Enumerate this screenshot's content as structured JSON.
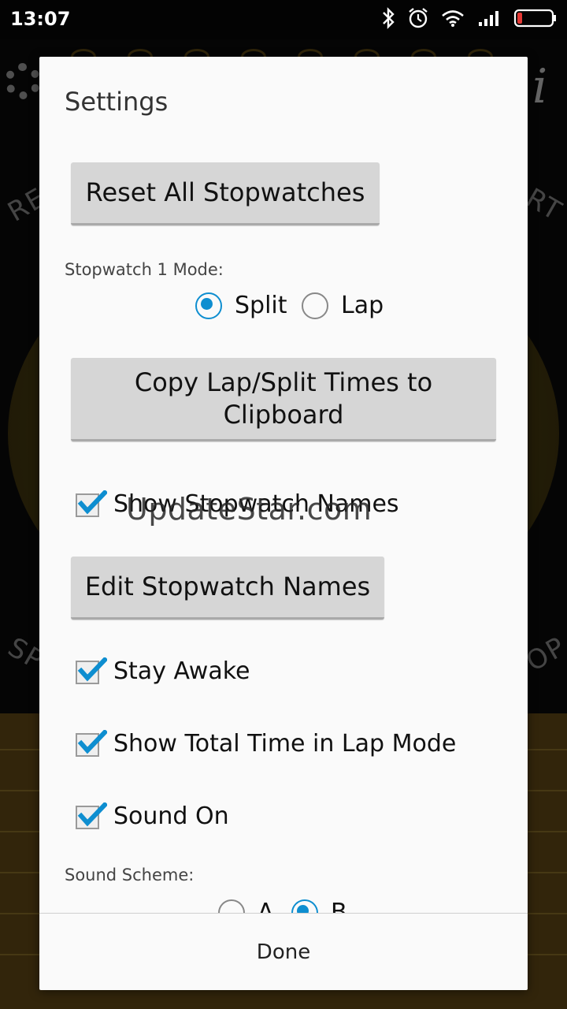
{
  "status_bar": {
    "time": "13:07"
  },
  "dialog": {
    "title": "Settings",
    "reset_button": "Reset All Stopwatches",
    "mode_label": "Stopwatch 1 Mode:",
    "mode_options": [
      {
        "label": "Split",
        "selected": true
      },
      {
        "label": "Lap",
        "selected": false
      }
    ],
    "copy_button": "Copy Lap/Split Times to Clipboard",
    "show_names": {
      "label": "Show Stopwatch Names",
      "checked": true
    },
    "edit_names_button": "Edit Stopwatch Names",
    "stay_awake": {
      "label": "Stay Awake",
      "checked": true
    },
    "show_total": {
      "label": "Show Total Time in Lap Mode",
      "checked": true
    },
    "sound_on": {
      "label": "Sound On",
      "checked": true
    },
    "sound_scheme_label": "Sound Scheme:",
    "sound_scheme_options": [
      {
        "label": "A",
        "selected": false
      },
      {
        "label": "B",
        "selected": true
      }
    ],
    "done_button": "Done"
  },
  "watermark": "UpdateStar.com",
  "colors": {
    "accent": "#0e8ed0",
    "button_bg": "#d6d6d6",
    "dialog_bg": "#fafafa"
  }
}
